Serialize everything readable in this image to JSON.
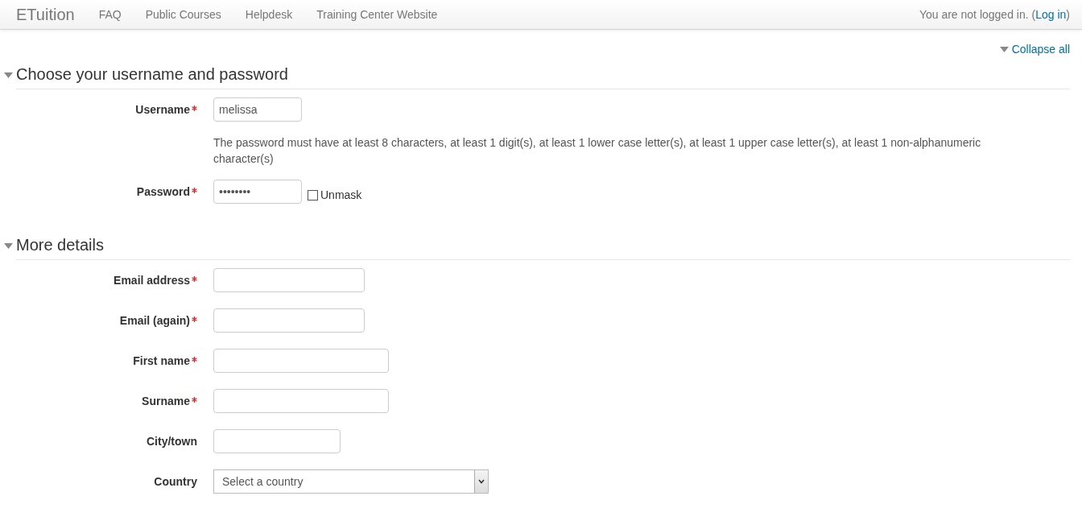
{
  "navbar": {
    "brand": "ETuition",
    "links": [
      "FAQ",
      "Public Courses",
      "Helpdesk",
      "Training Center Website"
    ],
    "login_status": {
      "prefix": "You are not logged in. (",
      "link": "Log in",
      "suffix": ")"
    }
  },
  "collapse_all": "Collapse all",
  "sections": [
    {
      "title": "Choose your username and password",
      "expanded": true,
      "rows": [
        {
          "kind": "text",
          "label": "Username",
          "required": true,
          "value": "melissa"
        },
        {
          "kind": "note",
          "text": "The password must have at least 8 characters, at least 1 digit(s), at least 1 lower case letter(s), at least 1 upper case letter(s), at least 1 non-alphanumeric character(s)"
        },
        {
          "kind": "password",
          "label": "Password",
          "required": true,
          "value": "••••••••",
          "unmask": {
            "label": "Unmask",
            "checked": false
          }
        }
      ]
    },
    {
      "title": "More details",
      "expanded": true,
      "rows": [
        {
          "kind": "text",
          "label": "Email address",
          "required": true
        },
        {
          "kind": "text",
          "label": "Email (again)",
          "required": true
        },
        {
          "kind": "text",
          "label": "First name",
          "required": true
        },
        {
          "kind": "text",
          "label": "Surname",
          "required": true
        },
        {
          "kind": "text",
          "label": "City/town",
          "required": false
        },
        {
          "kind": "select",
          "label": "Country",
          "required": false,
          "placeholder": "Select a country"
        }
      ]
    }
  ]
}
